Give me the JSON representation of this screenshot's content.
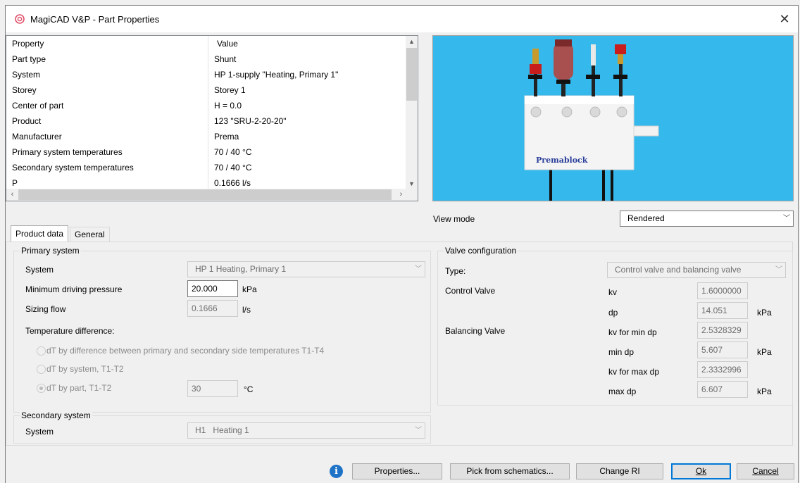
{
  "window": {
    "title": "MagiCAD V&P - Part Properties",
    "close_label": "✕",
    "icons": {
      "app": "magicad-logo-icon",
      "close": "close-icon"
    }
  },
  "grid": {
    "header": {
      "property": "Property",
      "value": "Value"
    },
    "rows": [
      {
        "property": "Part type",
        "value": "Shunt"
      },
      {
        "property": "System",
        "value": "HP 1-supply \"Heating, Primary 1\""
      },
      {
        "property": "Storey",
        "value": "Storey 1"
      },
      {
        "property": "Center of part",
        "value": "H = 0.0"
      },
      {
        "property": "Product",
        "value": "123 \"SRU-2-20-20\""
      },
      {
        "property": "Manufacturer",
        "value": "Prema"
      },
      {
        "property": "Primary system temperatures",
        "value": "70 / 40 °C"
      },
      {
        "property": "Secondary system temperatures",
        "value": "70 / 40 °C"
      },
      {
        "property": "P",
        "value": "0.1666 l/s"
      }
    ]
  },
  "preview": {
    "brand": "Premablock",
    "background": "#35b9ec"
  },
  "view_mode": {
    "label": "View mode",
    "value": "Rendered"
  },
  "tabs": [
    {
      "label": "Product data"
    },
    {
      "label": "General"
    }
  ],
  "primary": {
    "legend": "Primary system",
    "system_label": "System",
    "system_value": "HP 1 Heating, Primary 1",
    "min_pressure_label": "Minimum driving pressure",
    "min_pressure_value": "20.000",
    "min_pressure_unit": "kPa",
    "sizing_flow_label": "Sizing flow",
    "sizing_flow_value": "0.1666",
    "sizing_flow_unit": "l/s",
    "temp_diff_label": "Temperature difference:",
    "radio1": "dT by difference between primary and secondary side temperatures T1-T4",
    "radio2": "dT by system, T1-T2",
    "radio3": "dT by part, T1-T2",
    "dt_value": "30",
    "dt_unit": "°C"
  },
  "secondary": {
    "legend": "Secondary system",
    "system_label": "System",
    "system_value": "H1   Heating 1"
  },
  "valve": {
    "legend": "Valve configuration",
    "type_label": "Type:",
    "type_value": "Control valve and balancing valve",
    "control_label": "Control Valve",
    "kv_label": "kv",
    "kv_value": "1.6000000",
    "dp_label": "dp",
    "dp_value": "14.051",
    "dp_unit": "kPa",
    "balancing_label": "Balancing Valve",
    "kvmin_label": "kv for min dp",
    "kvmin_value": "2.5328329",
    "mindp_label": "min dp",
    "mindp_value": "5.607",
    "mindp_unit": "kPa",
    "kvmax_label": "kv for max dp",
    "kvmax_value": "2.3332996",
    "maxdp_label": "max dp",
    "maxdp_value": "6.607",
    "maxdp_unit": "kPa"
  },
  "buttons": {
    "info_glyph": "i",
    "properties": "Properties...",
    "pick": "Pick from schematics...",
    "change_ri": "Change RI",
    "ok": "Ok",
    "cancel": "Cancel"
  }
}
